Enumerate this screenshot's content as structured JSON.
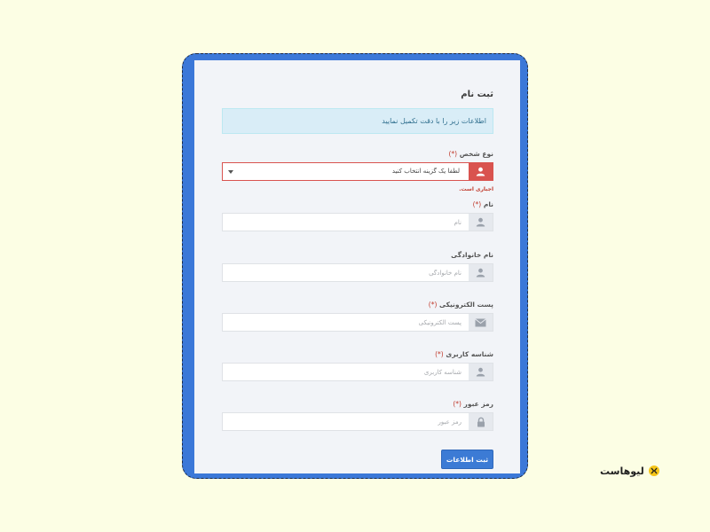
{
  "form": {
    "title": "ثبت نام",
    "info": "اطلاعات زیر را با دقت تکمیل نمایید",
    "required_mark": "(*)",
    "person_type": {
      "label": "نوع شخص",
      "selected": "لطفا یک گزینه انتخاب کنید",
      "error": "اجباری است."
    },
    "first_name": {
      "label": "نام",
      "placeholder": "نام"
    },
    "last_name": {
      "label": "نام خانوادگی",
      "placeholder": "نام خانوادگی"
    },
    "email": {
      "label": "پست الکترونیکی",
      "placeholder": "پست الکترونیکی"
    },
    "username": {
      "label": "شناسه کاربری",
      "placeholder": "شناسه کاربری"
    },
    "password": {
      "label": "رمز عبور",
      "placeholder": "رمز عبور"
    },
    "submit_label": "ثبت اطلاعات"
  },
  "icons": {
    "person": "user-icon",
    "email": "envelope-icon",
    "password": "lock-icon"
  },
  "brand": {
    "name": "لیوهاست"
  },
  "colors": {
    "background": "#fcfee4",
    "frame": "#3b78d8",
    "primary_button": "#3c7bd5",
    "error": "#d9534f",
    "info_bg": "#d9edf7"
  }
}
